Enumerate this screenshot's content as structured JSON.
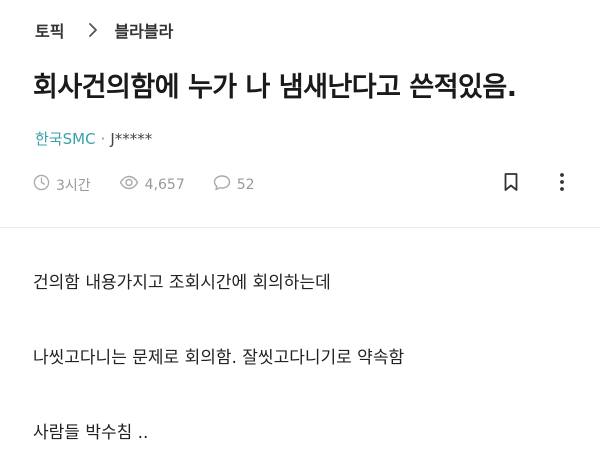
{
  "breadcrumb": {
    "category": "토픽",
    "subcategory": "블라블라"
  },
  "post": {
    "title": "회사건의함에 누가 나 냄새난다고 쓴적있음.",
    "company": "한국SMC",
    "separator": "·",
    "author": "J*****",
    "time": "3시간",
    "views": "4,657",
    "comments": "52",
    "body": [
      "건의함 내용가지고 조회시간에 회의하는데",
      "나씻고다니는 문제로 회의함. 잘씻고다니기로 약속함",
      "사람들 박수침 .."
    ]
  },
  "icons": {
    "time": "clock-icon",
    "views": "eye-icon",
    "comments": "comment-bubble-icon",
    "bookmark": "bookmark-icon",
    "more": "more-vertical-icon",
    "breadcrumb_separator": "chevron-right-icon"
  },
  "colors": {
    "company": "#3aa0a8",
    "meta": "#999999",
    "title": "#1a1a1a"
  }
}
